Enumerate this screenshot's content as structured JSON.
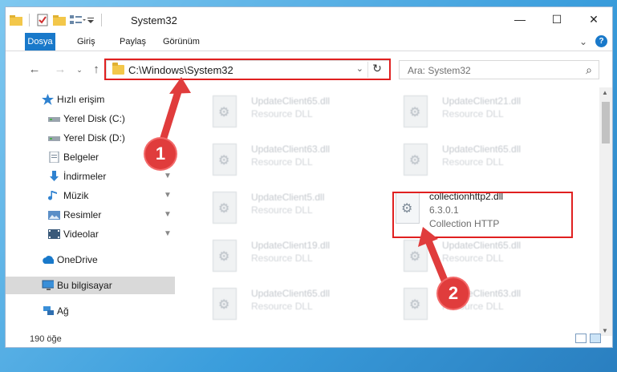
{
  "window": {
    "title": "System32",
    "controls": {
      "minimize": "—",
      "maximize": "☐",
      "close": "✕"
    }
  },
  "ribbon": {
    "tabs": [
      "Dosya",
      "Giriş",
      "Paylaş",
      "Görünüm"
    ],
    "expand_glyph": "⌄",
    "help_glyph": "?"
  },
  "nav": {
    "back_glyph": "←",
    "forward_glyph": "→",
    "recent_glyph": "⌄",
    "up_glyph": "↑",
    "address": "C:\\Windows\\System32",
    "address_dropdown": "⌄",
    "refresh_glyph": "↻",
    "search_placeholder": "Ara: System32",
    "search_icon": "⌕"
  },
  "sidebar": {
    "items": [
      {
        "label": "Hızlı erişim",
        "icon": "star-icon",
        "pinned": false
      },
      {
        "label": "Yerel Disk (C:)",
        "icon": "drive-icon",
        "pinned": false
      },
      {
        "label": "Yerel Disk (D:)",
        "icon": "drive-icon",
        "pinned": false
      },
      {
        "label": "Belgeler",
        "icon": "documents-icon",
        "pinned": true
      },
      {
        "label": "İndirmeler",
        "icon": "downloads-icon",
        "pinned": true
      },
      {
        "label": "Müzik",
        "icon": "music-icon",
        "pinned": true
      },
      {
        "label": "Resimler",
        "icon": "pictures-icon",
        "pinned": true
      },
      {
        "label": "Videolar",
        "icon": "videos-icon",
        "pinned": true
      },
      {
        "label": "OneDrive",
        "icon": "cloud-icon",
        "pinned": false
      },
      {
        "label": "Bu bilgisayar",
        "icon": "computer-icon",
        "pinned": false,
        "selected": true
      },
      {
        "label": "Ağ",
        "icon": "network-icon",
        "pinned": false
      }
    ],
    "pin_glyph": "📌"
  },
  "files": {
    "left": [
      {
        "name": "UpdateClient65.dll",
        "type": "Resource DLL"
      },
      {
        "name": "UpdateClient63.dll",
        "type": "Resource DLL"
      },
      {
        "name": "UpdateClient5.dll",
        "type": "Resource DLL"
      },
      {
        "name": "UpdateClient19.dll",
        "type": "Resource DLL"
      },
      {
        "name": "UpdateClient65.dll",
        "type": "Resource DLL"
      }
    ],
    "right": [
      {
        "name": "UpdateClient21.dll",
        "type": "Resource DLL"
      },
      {
        "name": "UpdateClient65.dll",
        "type": "Resource DLL"
      },
      {
        "name": "UpdateClient65.dll",
        "type": "Resource DLL"
      },
      {
        "name": "UpdateClient63.dll",
        "type": "Resource DLL"
      }
    ],
    "highlighted": {
      "name": "collectionhttp2.dll",
      "version": "6.3.0.1",
      "description": "Collection HTTP"
    }
  },
  "status": {
    "count": "190 öğe"
  },
  "callouts": [
    "1",
    "2"
  ],
  "colors": {
    "accent": "#1979ca",
    "highlight": "#e02020",
    "callout": "#e03c3c"
  }
}
